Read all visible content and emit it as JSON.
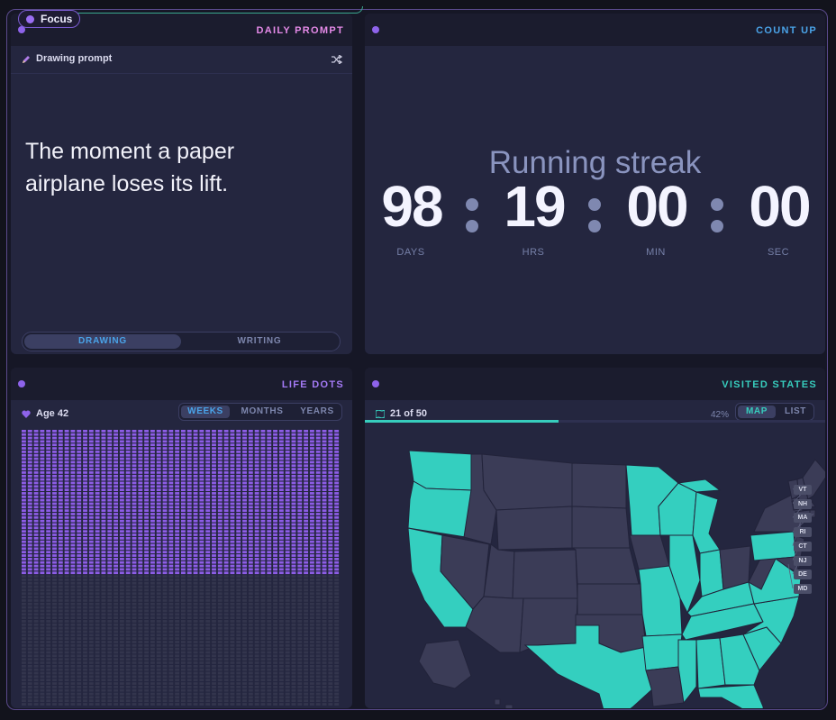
{
  "focus_pill": {
    "label": "Focus"
  },
  "daily_prompt": {
    "title": "DAILY PROMPT",
    "subheader": "Drawing prompt",
    "prompt": "The moment a paper airplane loses its lift.",
    "modes": [
      "DRAWING",
      "WRITING"
    ],
    "active_mode": "DRAWING",
    "icons": [
      "pencil-icon",
      "shuffle-icon"
    ]
  },
  "count_up": {
    "title": "COUNT UP",
    "label": "Running streak",
    "values": {
      "days": "98",
      "hrs": "19",
      "min": "00",
      "sec": "00"
    },
    "units": {
      "days": "DAYS",
      "hrs": "HRS",
      "min": "MIN",
      "sec": "SEC"
    }
  },
  "life_dots": {
    "title": "LIFE DOTS",
    "age_label": "Age 42",
    "tabs": [
      "WEEKS",
      "MONTHS",
      "YEARS"
    ],
    "active_tab": "WEEKS",
    "age": 42,
    "lifespan_years": 80,
    "weeks_per_year": 52,
    "colors": {
      "lived": "#8d5de6",
      "remaining": "#33354d"
    }
  },
  "visited_states": {
    "title": "VISITED STATES",
    "count_label": "21 of 50",
    "percent_label": "42%",
    "progress": 0.42,
    "tabs": [
      "MAP",
      "LIST"
    ],
    "active_tab": "MAP",
    "visited": [
      "WA",
      "OR",
      "CA",
      "TX",
      "MO",
      "MN",
      "WI",
      "MI",
      "IL",
      "IN",
      "KY",
      "TN",
      "MS",
      "AL",
      "GA",
      "FL",
      "SC",
      "NC",
      "VA",
      "PA",
      "AR"
    ],
    "callouts": [
      "VT",
      "NH",
      "MA",
      "RI",
      "CT",
      "NJ",
      "DE",
      "MD"
    ],
    "colors": {
      "visited": "#34cfbf",
      "unvisited": "#3b3c57",
      "border": "#22233a"
    }
  },
  "theme": {
    "accent_purple": "#9b6ef3",
    "accent_teal": "#37cdbd",
    "accent_blue": "#4aa3e8",
    "prompt_title": "#e58ae8"
  }
}
